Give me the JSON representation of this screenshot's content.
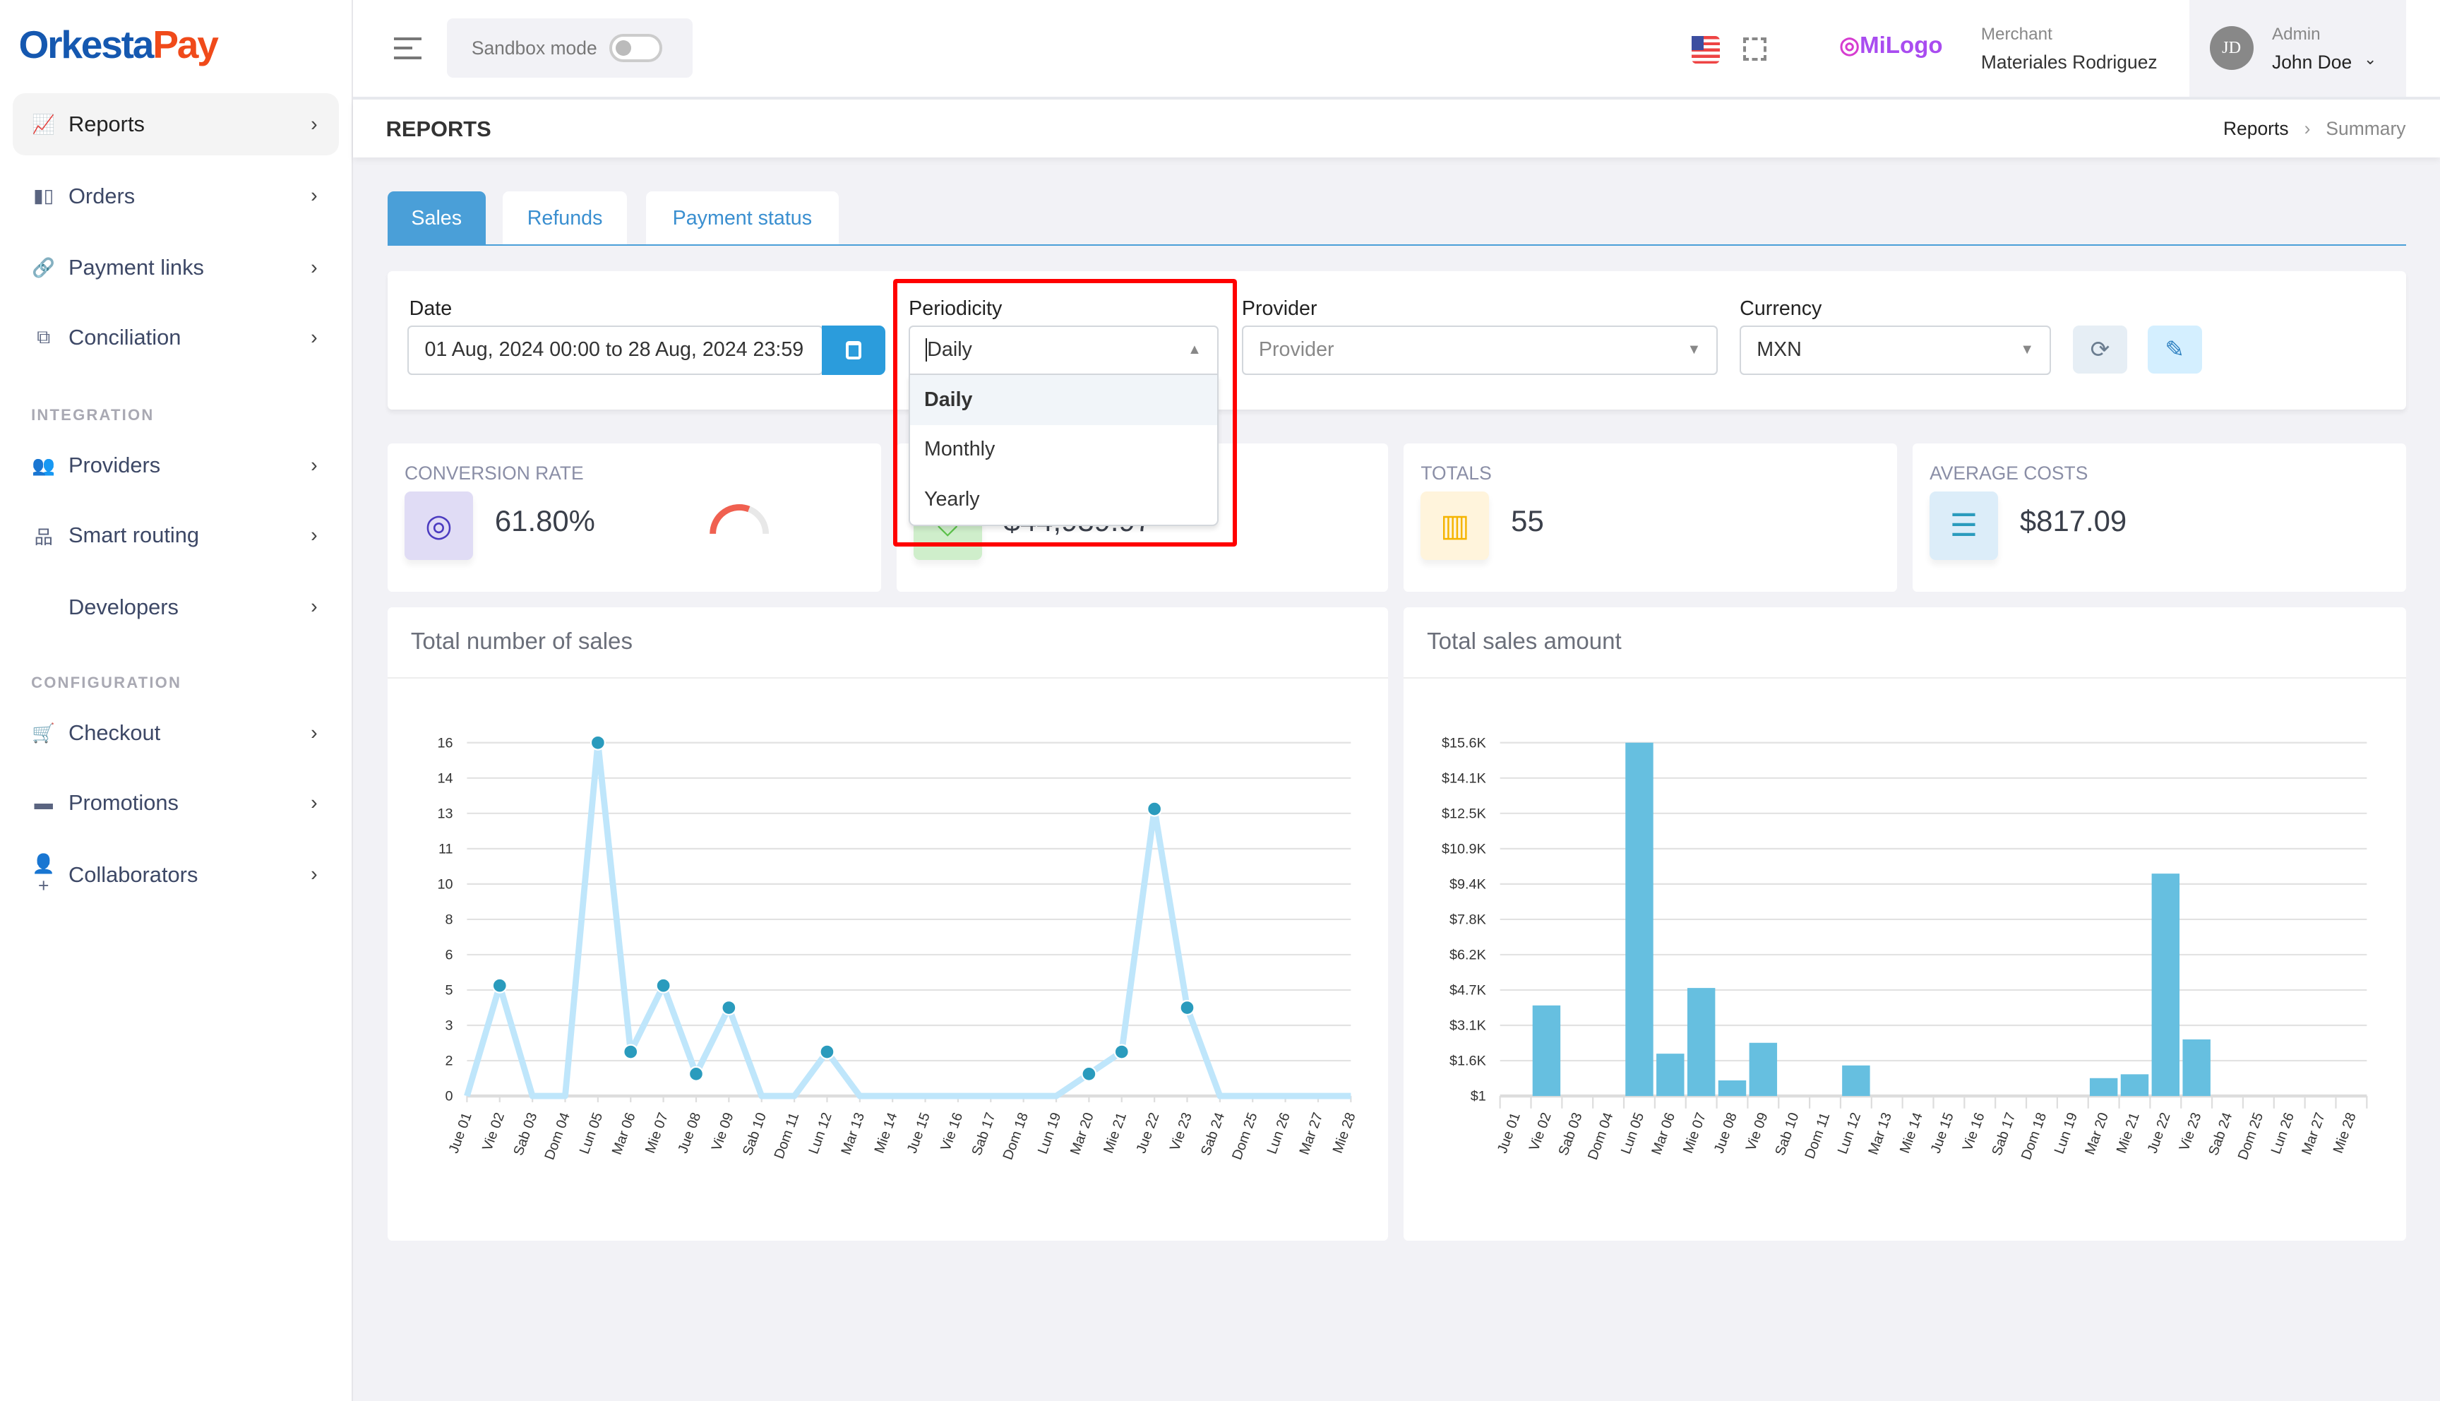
{
  "brand": {
    "part1": "Orkesta",
    "part2": "Pay"
  },
  "sidebar": {
    "items": [
      {
        "label": "Reports",
        "icon": "chart-line-icon",
        "active": true
      },
      {
        "label": "Orders",
        "icon": "book-icon"
      },
      {
        "label": "Payment links",
        "icon": "link-icon"
      },
      {
        "label": "Conciliation",
        "icon": "copy-icon"
      }
    ],
    "integration_label": "INTEGRATION",
    "integration": [
      {
        "label": "Providers",
        "icon": "users-icon"
      },
      {
        "label": "Smart routing",
        "icon": "sitemap-icon"
      },
      {
        "label": "Developers",
        "icon": "code-icon"
      }
    ],
    "configuration_label": "CONFIGURATION",
    "configuration": [
      {
        "label": "Checkout",
        "icon": "cart-icon"
      },
      {
        "label": "Promotions",
        "icon": "ticket-icon"
      },
      {
        "label": "Collaborators",
        "icon": "user-plus-icon"
      }
    ]
  },
  "header": {
    "sandbox_label": "Sandbox mode",
    "sandbox_on": false,
    "merchant_logo": "MiLogo",
    "merchant_label": "Merchant",
    "merchant_name": "Materiales Rodriguez",
    "role": "Admin",
    "user": "John Doe",
    "initials": "JD"
  },
  "page": {
    "title": "REPORTS",
    "breadcrumb": [
      "Reports",
      "Summary"
    ]
  },
  "tabs": [
    {
      "label": "Sales",
      "active": true
    },
    {
      "label": "Refunds"
    },
    {
      "label": "Payment status"
    }
  ],
  "filters": {
    "date_label": "Date",
    "date_value": "01 Aug, 2024 00:00 to 28 Aug, 2024 23:59",
    "periodicity_label": "Periodicity",
    "periodicity_value": "Daily",
    "periodicity_options": [
      "Daily",
      "Monthly",
      "Yearly"
    ],
    "provider_label": "Provider",
    "provider_placeholder": "Provider",
    "currency_label": "Currency",
    "currency_value": "MXN"
  },
  "stats": [
    {
      "label": "CONVERSION RATE",
      "value": "61.80%",
      "gauge_percent": 61.8,
      "icon": "conversion-icon"
    },
    {
      "label": "",
      "value": "$44,939.97",
      "icon": "money-icon"
    },
    {
      "label": "TOTALS",
      "value": "55",
      "icon": "bar-chart-icon"
    },
    {
      "label": "AVERAGE COSTS",
      "value": "$817.09",
      "icon": "list-icon"
    }
  ],
  "colors": {
    "accent": "#2b9cdc",
    "line": "#bfe6fb",
    "point": "#2a9bbd",
    "bar": "#66bfe0",
    "highlight": "#ff0000"
  },
  "chart_data": [
    {
      "type": "line",
      "title": "Total number of sales",
      "categories": [
        "Jue 01",
        "Vie 02",
        "Sab 03",
        "Dom 04",
        "Lun 05",
        "Mar 06",
        "Mie 07",
        "Jue 08",
        "Vie 09",
        "Sab 10",
        "Dom 11",
        "Lun 12",
        "Mar 13",
        "Mie 14",
        "Jue 15",
        "Vie 16",
        "Sab 17",
        "Dom 18",
        "Lun 19",
        "Mar 20",
        "Mie 21",
        "Jue 22",
        "Vie 23",
        "Sab 24",
        "Dom 25",
        "Lun 26",
        "Mar 27",
        "Mie 28"
      ],
      "values": [
        0,
        5,
        0,
        0,
        16,
        2,
        5,
        1,
        4,
        0,
        0,
        2,
        0,
        0,
        0,
        0,
        0,
        0,
        0,
        1,
        2,
        13,
        4,
        0,
        0,
        0,
        0,
        0
      ],
      "yticks": [
        "0",
        "2",
        "3",
        "5",
        "6",
        "8",
        "10",
        "11",
        "13",
        "14",
        "16"
      ],
      "ylim": [
        0,
        16
      ],
      "grid": true
    },
    {
      "type": "bar",
      "title": "Total sales amount",
      "categories": [
        "Jue 01",
        "Vie 02",
        "Sab 03",
        "Dom 04",
        "Lun 05",
        "Mar 06",
        "Mie 07",
        "Jue 08",
        "Vie 09",
        "Sab 10",
        "Dom 11",
        "Lun 12",
        "Mar 13",
        "Mie 14",
        "Jue 15",
        "Vie 16",
        "Sab 17",
        "Dom 18",
        "Lun 19",
        "Mar 20",
        "Mie 21",
        "Jue 22",
        "Vie 23",
        "Sab 24",
        "Dom 25",
        "Lun 26",
        "Mar 27",
        "Mie 28"
      ],
      "values": [
        0,
        4000,
        0,
        0,
        15600,
        1870,
        4770,
        690,
        2350,
        0,
        0,
        1350,
        0,
        0,
        0,
        0,
        0,
        0,
        0,
        790,
        960,
        9820,
        2500,
        0,
        0,
        0,
        0,
        0
      ],
      "yticks": [
        "$1",
        "$1.6K",
        "$3.1K",
        "$4.7K",
        "$6.2K",
        "$7.8K",
        "$9.4K",
        "$10.9K",
        "$12.5K",
        "$14.1K",
        "$15.6K"
      ],
      "ylim": [
        1,
        15600
      ],
      "grid": true
    }
  ]
}
